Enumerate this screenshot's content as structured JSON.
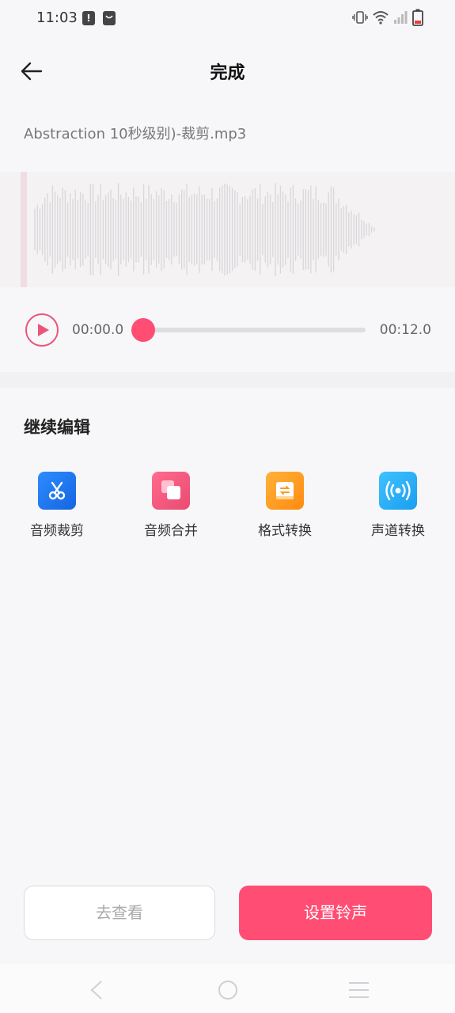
{
  "status_bar": {
    "time": "11:03",
    "notification_badge": "!",
    "icons": [
      "vibrate-icon",
      "wifi-icon",
      "signal-icon",
      "battery-icon"
    ]
  },
  "header": {
    "title": "完成",
    "back_icon": "arrow-left-icon"
  },
  "file": {
    "name": "Abstraction 10秒级别)-裁剪.mp3"
  },
  "player": {
    "current_time": "00:00.0",
    "duration": "00:12.0",
    "progress": 0,
    "accent_color": "#ff4d73"
  },
  "edit_section": {
    "title": "继续编辑",
    "tools": [
      {
        "label": "音频裁剪",
        "icon": "scissors-icon",
        "color": "#1e7bf0"
      },
      {
        "label": "音频合并",
        "icon": "merge-icon",
        "color": "#f0547a"
      },
      {
        "label": "格式转换",
        "icon": "convert-icon",
        "color": "#ff9a1e"
      },
      {
        "label": "声道转换",
        "icon": "broadcast-icon",
        "color": "#2bb0f5"
      }
    ]
  },
  "actions": {
    "view_label": "去查看",
    "set_ringtone_label": "设置铃声"
  },
  "nav": {
    "icons": [
      "nav-back-icon",
      "nav-home-icon",
      "nav-menu-icon"
    ]
  }
}
